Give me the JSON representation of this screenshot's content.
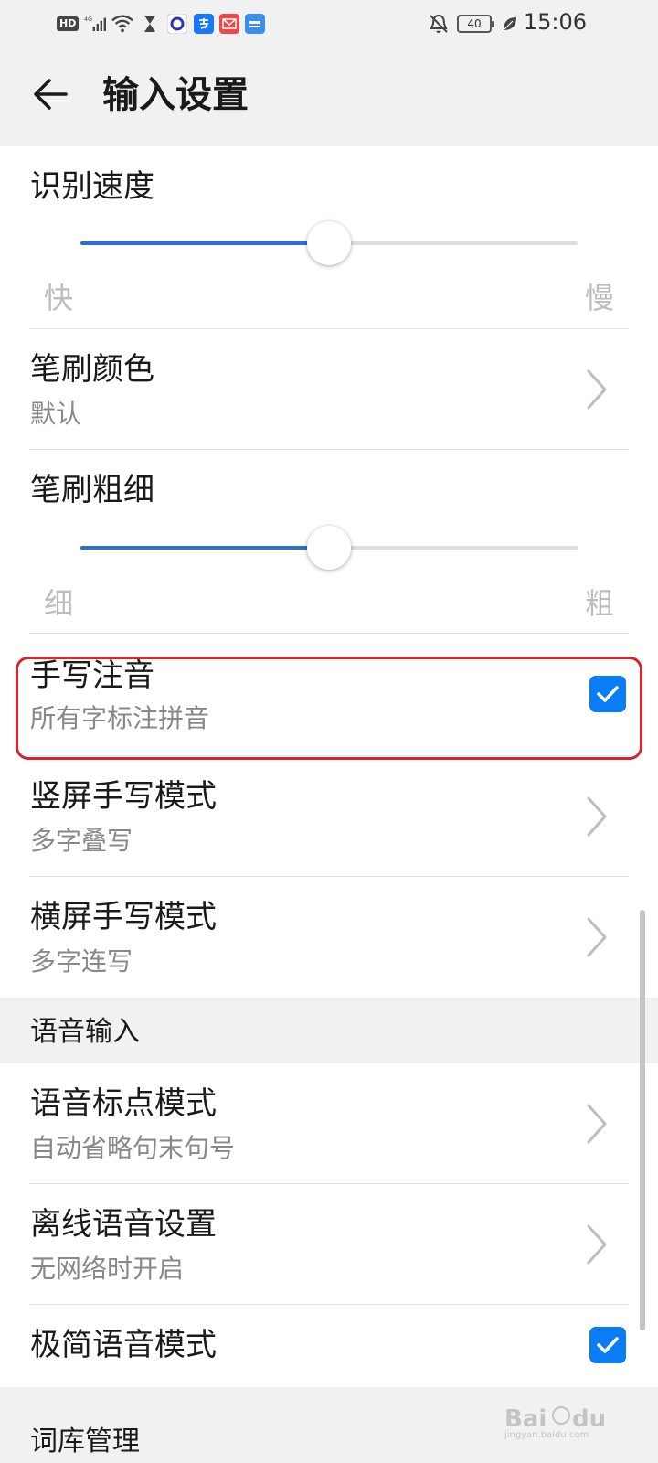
{
  "status_bar": {
    "network_badge": "HD",
    "network_type": "4G",
    "battery": "40",
    "time": "15:06",
    "icons": [
      "hd-icon",
      "signal-icon",
      "wifi-icon",
      "hourglass-icon",
      "circle-app-icon",
      "alipay-icon",
      "mail-app-icon",
      "yunpan-app-icon",
      "mute-bell-icon",
      "battery-icon",
      "leaf-icon"
    ]
  },
  "header": {
    "title": "输入设置",
    "back_icon": "back-arrow-icon"
  },
  "handwriting": {
    "recognition_speed": {
      "label": "识别速度",
      "min_label": "快",
      "max_label": "慢",
      "value_fraction": 0.5
    },
    "brush_color": {
      "label": "笔刷颜色",
      "value": "默认"
    },
    "brush_thickness": {
      "label": "笔刷粗细",
      "min_label": "细",
      "max_label": "粗",
      "value_fraction": 0.5
    },
    "handwriting_pinyin": {
      "label": "手写注音",
      "value": "所有字标注拼音",
      "checked": true
    },
    "portrait_mode": {
      "label": "竖屏手写模式",
      "value": "多字叠写"
    },
    "landscape_mode": {
      "label": "横屏手写模式",
      "value": "多字连写"
    }
  },
  "voice_section": {
    "header": "语音输入",
    "punctuation": {
      "label": "语音标点模式",
      "value": "自动省略句末句号"
    },
    "offline": {
      "label": "离线语音设置",
      "value": "无网络时开启"
    },
    "minimal": {
      "label": "极简语音模式",
      "checked": true
    }
  },
  "dictionary_section": {
    "header": "词库管理"
  },
  "colors": {
    "accent": "#0a7cf4",
    "slider_fill": "#2a6ed6",
    "highlight": "#d8242f",
    "background": "#f1f1f1"
  }
}
